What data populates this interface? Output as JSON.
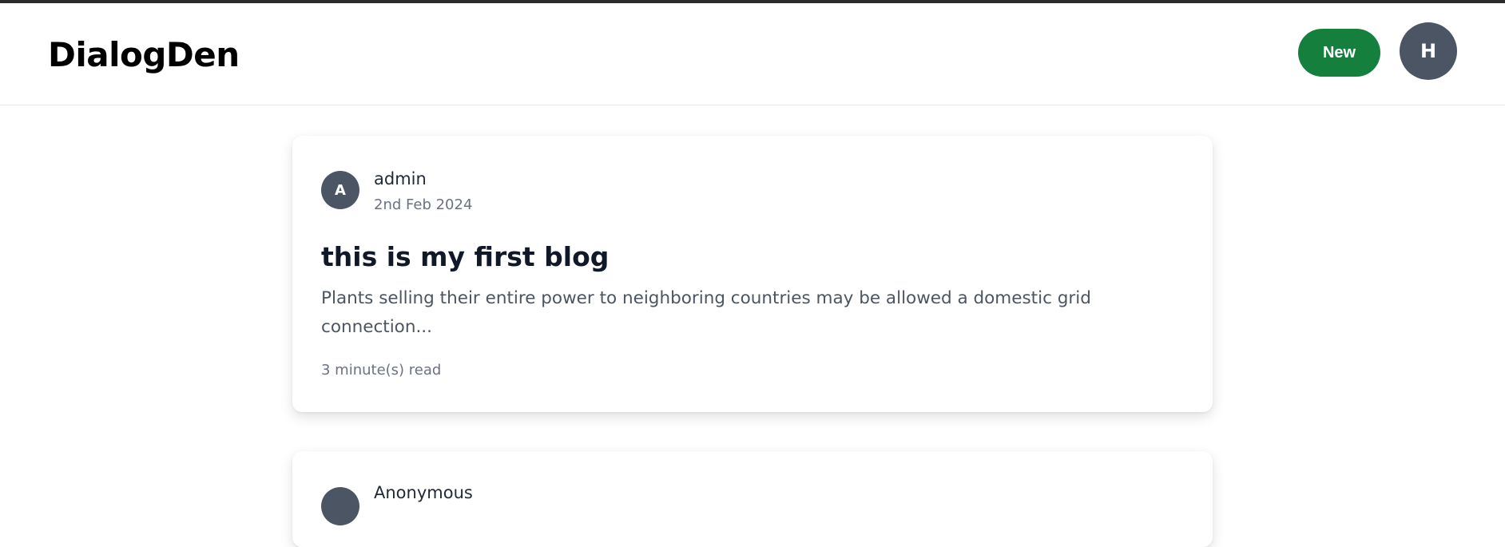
{
  "header": {
    "brand": "DialogDen",
    "new_button_label": "New",
    "user_initial": "H"
  },
  "posts": [
    {
      "author_initial": "A",
      "author_name": "admin",
      "date": "2nd Feb 2024",
      "title": "this is my first blog",
      "excerpt": "Plants selling their entire power to neighboring countries may be allowed a domestic grid connection...",
      "read_time": "3 minute(s) read"
    },
    {
      "author_initial": "",
      "author_name": "Anonymous"
    }
  ],
  "colors": {
    "accent_green": "#15803d",
    "avatar_gray": "#4b5563",
    "top_strip": "#2b2b2b"
  },
  "icons": {
    "user_avatar": "avatar-circle",
    "author_avatar": "avatar-circle"
  }
}
